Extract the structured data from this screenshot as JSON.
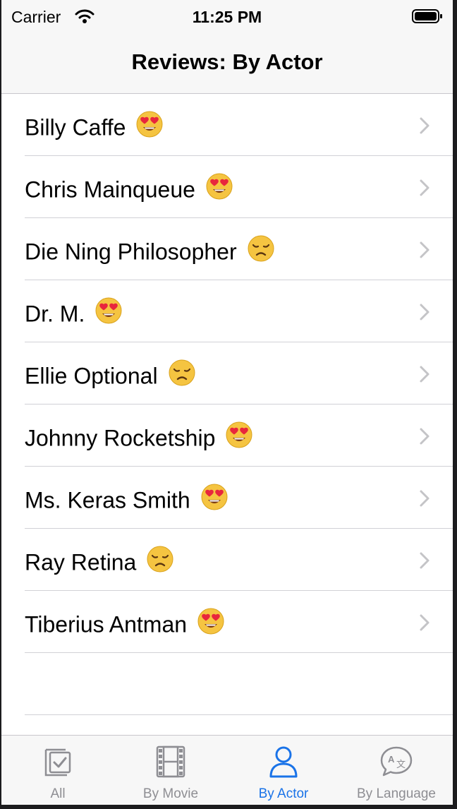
{
  "status_bar": {
    "carrier": "Carrier",
    "time": "11:25 PM"
  },
  "nav": {
    "title": "Reviews: By Actor"
  },
  "colors": {
    "accent": "#1a73e8",
    "inactive": "#8e8e93",
    "separator": "#d1d1d6"
  },
  "rows": [
    {
      "name": "Billy Caffe",
      "emoji": "heart-eyes-emoji"
    },
    {
      "name": "Chris Mainqueue",
      "emoji": "heart-eyes-emoji"
    },
    {
      "name": "Die Ning Philosopher",
      "emoji": "disappointed-face-emoji"
    },
    {
      "name": "Dr. M.",
      "emoji": "heart-eyes-emoji"
    },
    {
      "name": "Ellie Optional",
      "emoji": "disappointed-face-emoji"
    },
    {
      "name": "Johnny Rocketship",
      "emoji": "heart-eyes-emoji"
    },
    {
      "name": "Ms. Keras Smith",
      "emoji": "heart-eyes-emoji"
    },
    {
      "name": "Ray Retina",
      "emoji": "disappointed-face-emoji"
    },
    {
      "name": "Tiberius Antman",
      "emoji": "heart-eyes-emoji"
    }
  ],
  "tabs": [
    {
      "label": "All",
      "icon": "checklist-icon",
      "active": false
    },
    {
      "label": "By Movie",
      "icon": "film-icon",
      "active": false
    },
    {
      "label": "By Actor",
      "icon": "person-icon",
      "active": true
    },
    {
      "label": "By Language",
      "icon": "translate-icon",
      "active": false
    }
  ]
}
